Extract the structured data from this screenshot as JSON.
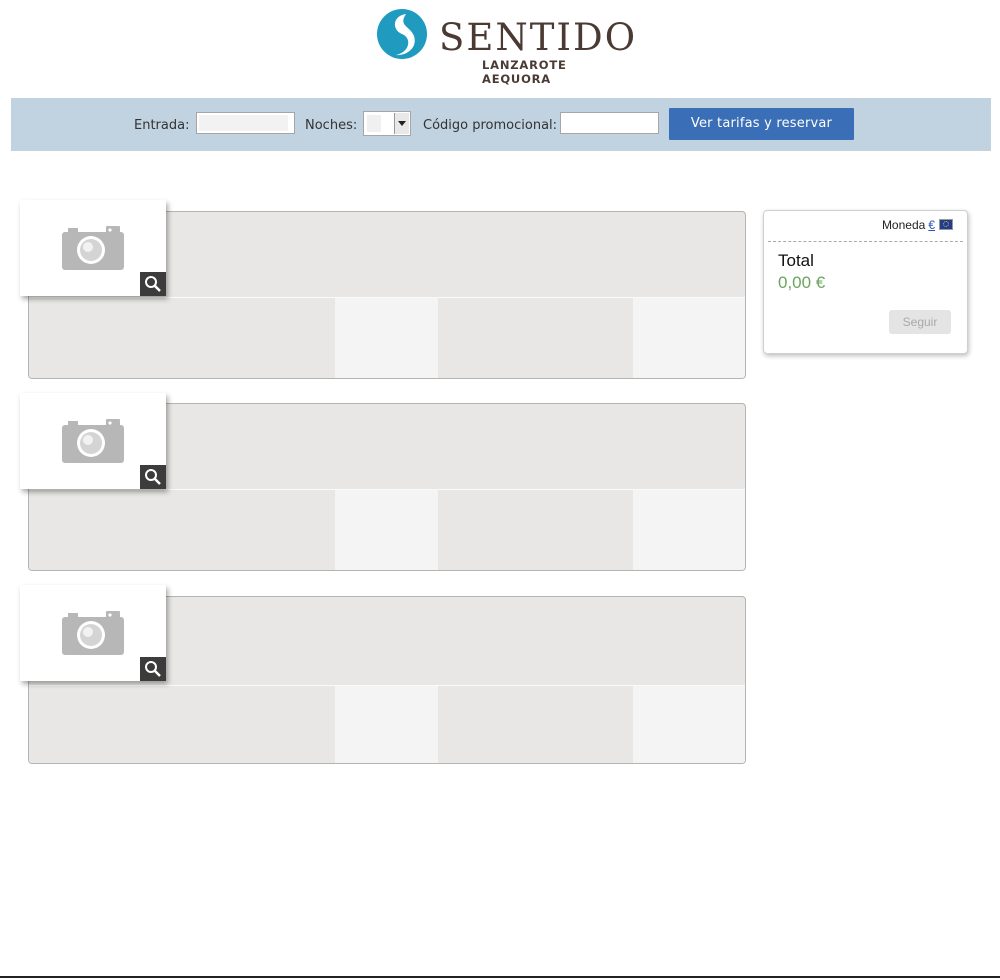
{
  "brand": {
    "name": "SENTIDO",
    "subtitle": "LANZAROTE AEQUORA",
    "colors": {
      "mark": "#1f9bbf",
      "text": "#4a3a33"
    }
  },
  "search": {
    "entrada_label": "Entrada:",
    "entrada_value": "",
    "noches_label": "Noches:",
    "noches_value": "",
    "promo_label": "Código promocional:",
    "promo_value": "",
    "submit_label": "Ver tarifas y reservar",
    "bar_color": "#c1d2e0",
    "button_color": "#3a6eb6"
  },
  "rooms": [
    {
      "image_icon": "camera-icon",
      "zoom_icon": "magnifier-icon"
    },
    {
      "image_icon": "camera-icon",
      "zoom_icon": "magnifier-icon"
    },
    {
      "image_icon": "camera-icon",
      "zoom_icon": "magnifier-icon"
    }
  ],
  "summary": {
    "currency_label": "Moneda",
    "currency_symbol": "€",
    "currency_flag_icon": "eu-flag-icon",
    "total_label": "Total",
    "total_value": "0,00 €",
    "continue_label": "Seguir",
    "total_color": "#6aa55e"
  }
}
